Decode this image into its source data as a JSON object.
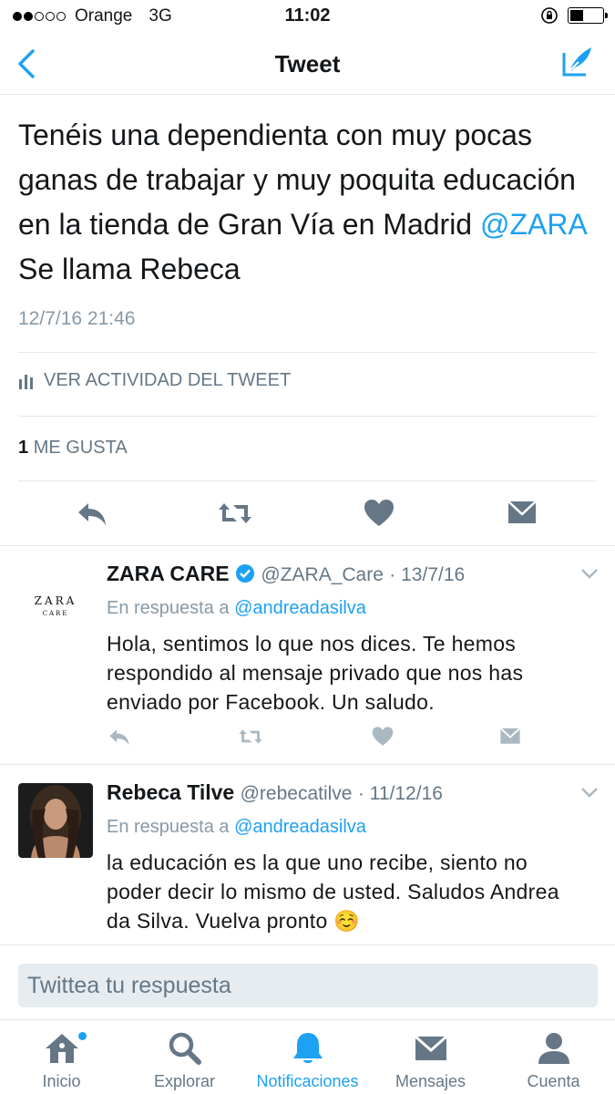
{
  "status_bar": {
    "carrier": "Orange",
    "network": "3G",
    "time": "11:02",
    "signal_bars_filled": 2,
    "signal_bars_total": 5
  },
  "nav": {
    "title": "Tweet",
    "back_icon": "chevron-left-icon",
    "compose_icon": "compose-tweet-icon"
  },
  "tweet": {
    "text_line1": "Tenéis una dependienta con muy pocas",
    "text_line2": "ganas de trabajar y muy poquita educación",
    "text_line3": "en la tienda de Gran Vía en Madrid",
    "mention": "@ZARA",
    "text_line4": "Se llama Rebeca",
    "date": "12/7/16 21:46",
    "activity_label": "VER ACTIVIDAD DEL TWEET",
    "likes_count": "1",
    "likes_label": "ME GUSTA"
  },
  "replies": [
    {
      "avatar_text": "ZARA",
      "avatar_subtext": "CARE",
      "name": "ZARA CARE",
      "verified": true,
      "handle": "@ZARA_Care",
      "date": "· 13/7/16",
      "reply_prefix": "En respuesta a",
      "reply_to": "@andreadasilva",
      "body": "Hola, sentimos lo que nos dices. Te hemos respondido al mensaje privado que nos has enviado por Facebook. Un saludo."
    },
    {
      "name": "Rebeca Tilve",
      "handle": "@rebecatilve",
      "date": "· 11/12/16",
      "reply_prefix": "En respuesta a",
      "reply_to": "@andreadasilva",
      "body": "la educación es la que uno recibe, siento no poder decir lo mismo de usted. Saludos Andrea da Silva. Vuelva pronto ☺️"
    }
  ],
  "reply_input": {
    "placeholder": "Twittea tu respuesta"
  },
  "tabs": [
    {
      "label": "Inicio",
      "icon": "home-icon"
    },
    {
      "label": "Explorar",
      "icon": "search-icon"
    },
    {
      "label": "Notificaciones",
      "icon": "bell-icon",
      "active": true
    },
    {
      "label": "Mensajes",
      "icon": "envelope-icon"
    },
    {
      "label": "Cuenta",
      "icon": "person-icon"
    }
  ],
  "colors": {
    "accent": "#1da1f2",
    "icon_gray": "#657786",
    "light_icon": "#aab8c2",
    "divider": "#e1e8ed"
  }
}
